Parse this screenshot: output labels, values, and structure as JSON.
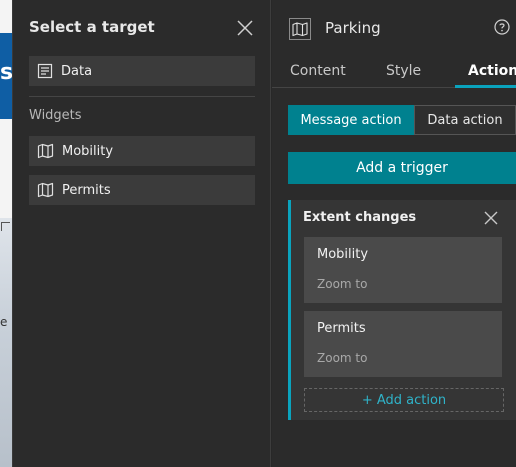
{
  "app_strip": {
    "glyph": "s",
    "edge_char": "e"
  },
  "target_panel": {
    "title": "Select a target",
    "data_item": "Data",
    "widgets_header": "Widgets",
    "widgets": [
      "Mobility",
      "Permits"
    ]
  },
  "settings": {
    "title": "Parking",
    "tabs": [
      "Content",
      "Style",
      "Action"
    ],
    "active_tab": "Action",
    "segments": {
      "message": "Message action",
      "data": "Data action"
    },
    "add_trigger": "Add a trigger",
    "trigger": {
      "title": "Extent changes",
      "actions": [
        {
          "name": "Mobility",
          "sub": "Zoom to"
        },
        {
          "name": "Permits",
          "sub": "Zoom to"
        }
      ],
      "add_action": "+ Add action"
    }
  },
  "colors": {
    "accent": "#00818f",
    "accent_line": "#0aa3bd",
    "link": "#2fb3c9",
    "panel": "#2b2b2b"
  }
}
